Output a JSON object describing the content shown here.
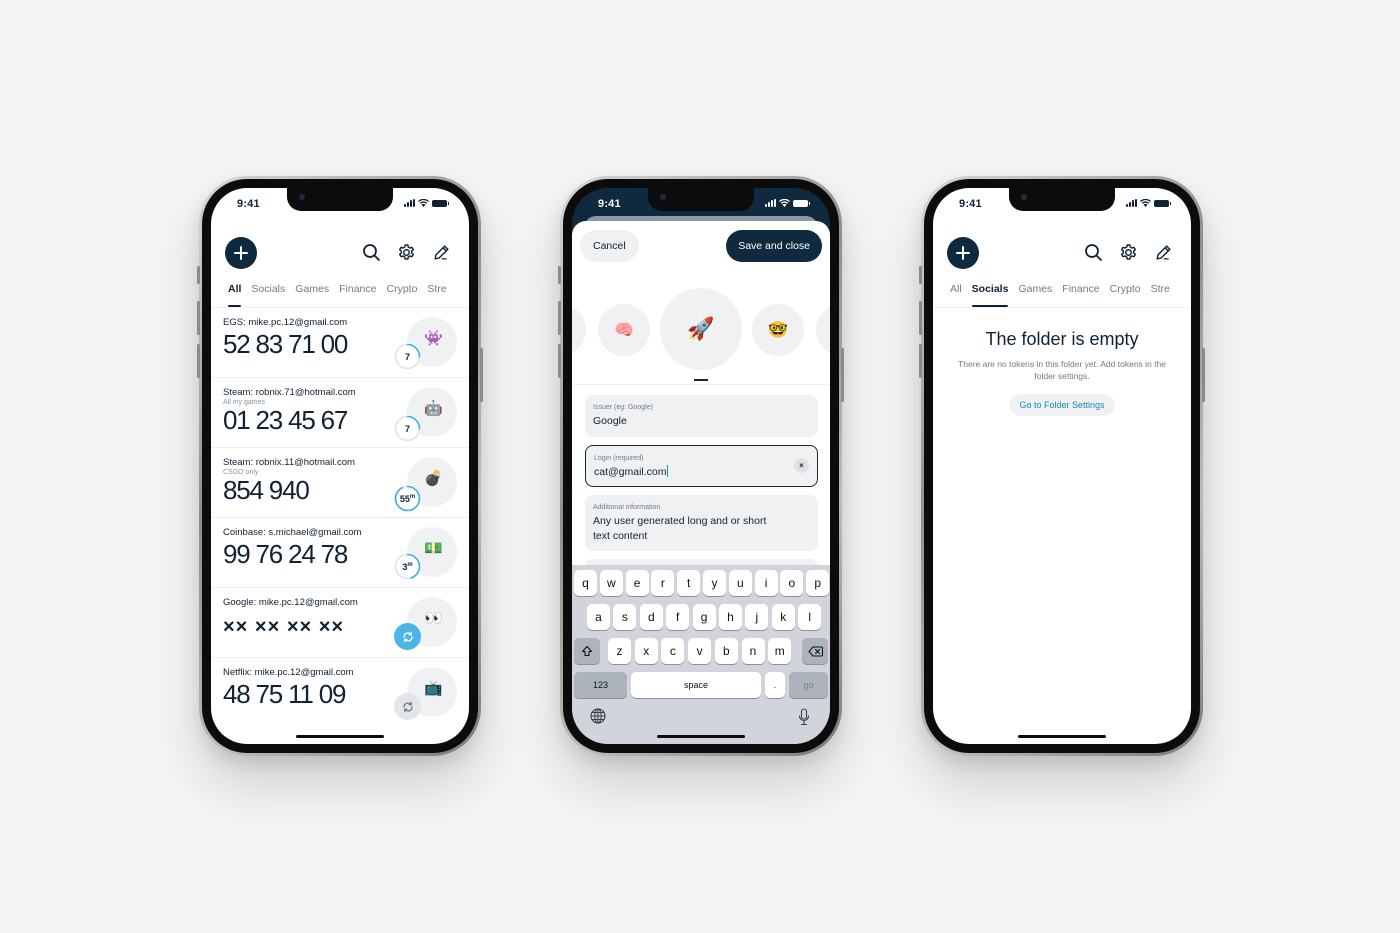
{
  "status_time": "9:41",
  "colors": {
    "accent_dark": "#0f2a3f",
    "timer_blue": "#3bb0e0",
    "link_blue": "#1787b8",
    "background": "#f4f4f4"
  },
  "icons": {
    "fab": "plus-icon",
    "search": "search-icon",
    "settings": "gear-icon",
    "edit": "pencil-icon",
    "refresh": "refresh-icon",
    "shift": "shift-arrow-icon",
    "backspace": "backspace-icon",
    "globe": "globe-icon",
    "mic": "microphone-icon"
  },
  "tabs": [
    "All",
    "Socials",
    "Games",
    "Finance",
    "Crypto",
    "Stre"
  ],
  "phone1": {
    "active_tab": "All",
    "tokens": [
      {
        "name": "EGS: mike.pc.12@gmail.com",
        "note": "",
        "code": "52 83 71 00",
        "emoji": "👾",
        "timer_label": "7",
        "timer_unit": "",
        "timer_progress": 0.25,
        "state": "timer"
      },
      {
        "name": "Steam: robnix.71@hotmail.com",
        "note": "All my games",
        "code": "01 23 45 67",
        "emoji": "🤖",
        "timer_label": "7",
        "timer_unit": "",
        "timer_progress": 0.25,
        "state": "timer"
      },
      {
        "name": "Steam: robnix.11@hotmail.com",
        "note": "CSGO only",
        "code": "854 940",
        "emoji": "💣",
        "timer_label": "55",
        "timer_unit": "m",
        "timer_progress": 0.92,
        "state": "timer"
      },
      {
        "name": "Coinbase: s.michael@gmail.com",
        "note": "",
        "code": "99 76 24 78",
        "emoji": "💵",
        "timer_label": "3",
        "timer_unit": "m",
        "timer_progress": 0.45,
        "state": "timer"
      },
      {
        "name": "Google: mike.pc.12@gmail.com",
        "note": "",
        "code": "×× ×× ×× ××",
        "emoji": "👀",
        "timer_label": "",
        "timer_unit": "",
        "timer_progress": 0,
        "state": "refresh-active"
      },
      {
        "name": "Netflix: mike.pc.12@gmail.com",
        "note": "",
        "code": "48 75 11 09",
        "emoji": "📺",
        "timer_label": "",
        "timer_unit": "",
        "timer_progress": 0,
        "state": "refresh-idle"
      }
    ]
  },
  "phone2": {
    "cancel_label": "Cancel",
    "save_label": "Save and close",
    "emoji_choices": [
      "🧠",
      "🚀",
      "🤓"
    ],
    "selected_emoji": "🚀",
    "fields": {
      "issuer": {
        "label": "Issuer (eg: Google)",
        "value": "Google"
      },
      "login": {
        "label": "Login (required)",
        "value": "cat@gmail.com"
      },
      "info": {
        "label": "Additional information",
        "value": "Any user generated long and or short text content"
      }
    },
    "clear_label": "×",
    "keyboard": {
      "row1": [
        "q",
        "w",
        "e",
        "r",
        "t",
        "y",
        "u",
        "i",
        "o",
        "p"
      ],
      "row2": [
        "a",
        "s",
        "d",
        "f",
        "g",
        "h",
        "j",
        "k",
        "l"
      ],
      "row3": [
        "z",
        "x",
        "c",
        "v",
        "b",
        "n",
        "m"
      ],
      "numbers": "123",
      "space": "space",
      "period": ".",
      "go": "go"
    }
  },
  "phone3": {
    "active_tab": "Socials",
    "empty_title": "The folder is empty",
    "empty_desc": "There are no tokens in this folder yet. Add tokens in the folder settings.",
    "empty_button": "Go to Folder Settings"
  }
}
